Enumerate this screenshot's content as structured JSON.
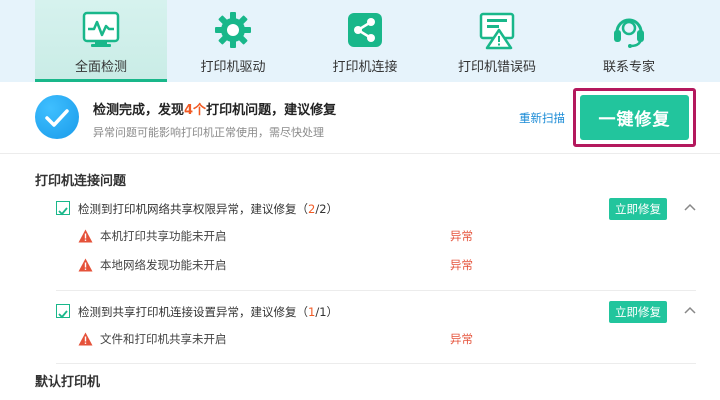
{
  "nav": {
    "tabs": [
      {
        "label": "全面检测",
        "icon": "monitor-pulse-icon",
        "active": true
      },
      {
        "label": "打印机驱动",
        "icon": "gear-icon",
        "active": false
      },
      {
        "label": "打印机连接",
        "icon": "share-icon",
        "active": false
      },
      {
        "label": "打印机错误码",
        "icon": "warning-screen-icon",
        "active": false
      },
      {
        "label": "联系专家",
        "icon": "headset-icon",
        "active": false
      }
    ]
  },
  "summary": {
    "title_prefix": "检测完成，发现",
    "count": "4个",
    "title_suffix": "打印机问题，建议修复",
    "subtitle": "异常问题可能影响打印机正常使用，需尽快处理",
    "rescan_label": "重新扫描",
    "fix_all_label": "一键修复"
  },
  "sections": {
    "connection_title": "打印机连接问题",
    "default_printer_title": "默认打印机"
  },
  "issues": [
    {
      "text": "检测到打印机网络共享权限异常，建议修复",
      "count_open": "（",
      "count_found": "2",
      "count_total": "/2）",
      "fix_label": "立即修复",
      "items": [
        {
          "text": "本机打印共享功能未开启",
          "status": "异常"
        },
        {
          "text": "本地网络发现功能未开启",
          "status": "异常"
        }
      ]
    },
    {
      "text": "检测到共享打印机连接设置异常，建议修复",
      "count_open": "（",
      "count_found": "1",
      "count_total": "/1）",
      "fix_label": "立即修复",
      "items": [
        {
          "text": "文件和打印机共享未开启",
          "status": "异常"
        }
      ]
    }
  ],
  "colors": {
    "accent": "#22c59d",
    "highlight": "#f15a24",
    "link": "#1a8bd6",
    "error": "#e5523a",
    "frame": "#b4185d"
  }
}
